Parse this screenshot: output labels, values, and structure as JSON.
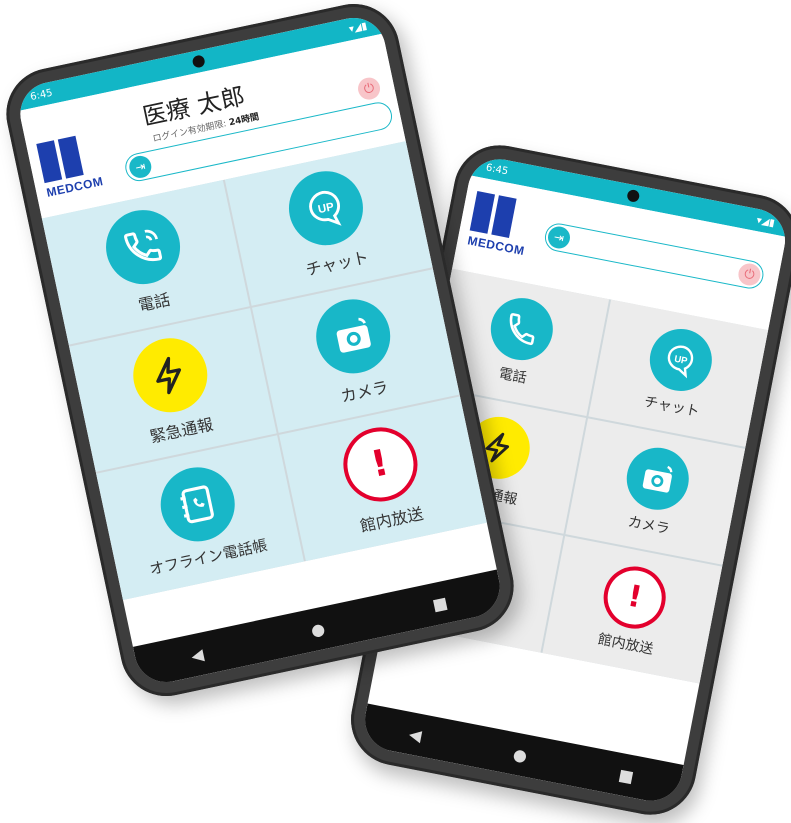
{
  "status": {
    "time": "6:45"
  },
  "user": {
    "name": "医療 太郎",
    "login_label": "ログイン有効期限:",
    "login_value": "24時間"
  },
  "logo": {
    "text": "MEDCOM"
  },
  "tiles": {
    "phone": "電話",
    "chat": "チャット",
    "chat_badge": "UP",
    "emergency": "緊急通報",
    "camera": "カメラ",
    "offline_book": "オフライン電話帳",
    "broadcast": "館内放送",
    "offline_book_partial": "話帳"
  },
  "colors": {
    "accent": "#18b7c8",
    "logo": "#1d3fae",
    "emergency": "#ffeb00",
    "alert": "#e3002d"
  },
  "icons": [
    "phone-icon",
    "chat-icon",
    "lightning-icon",
    "camera-icon",
    "address-book-icon",
    "exclamation-icon",
    "logout-icon",
    "power-icon",
    "back-icon",
    "home-icon",
    "recent-apps-icon"
  ]
}
